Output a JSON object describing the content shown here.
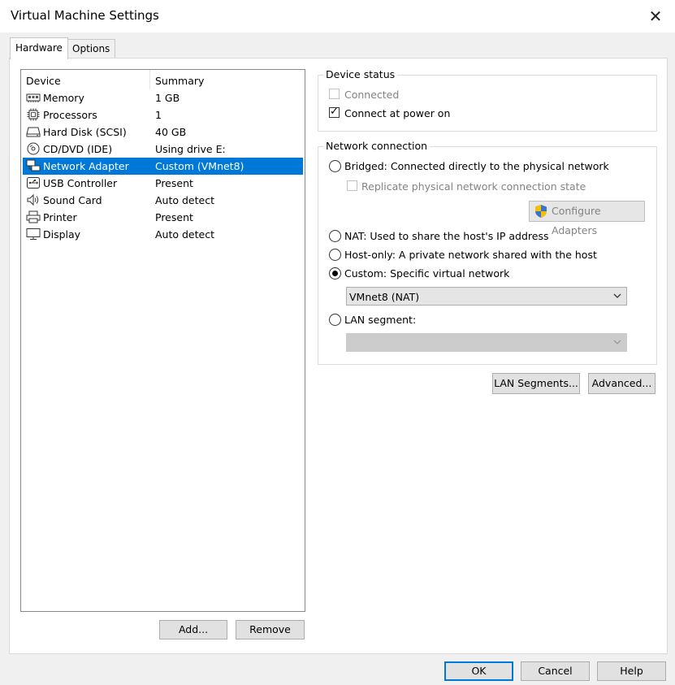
{
  "window": {
    "title": "Virtual Machine Settings"
  },
  "tabs": [
    {
      "label": "Hardware",
      "active": true
    },
    {
      "label": "Options",
      "active": false
    }
  ],
  "device_list": {
    "columns": {
      "device": "Device",
      "summary": "Summary"
    },
    "rows": [
      {
        "icon": "memory-icon",
        "name": "Memory",
        "summary": "1 GB",
        "selected": false
      },
      {
        "icon": "processor-icon",
        "name": "Processors",
        "summary": "1",
        "selected": false
      },
      {
        "icon": "hard-disk-icon",
        "name": "Hard Disk (SCSI)",
        "summary": "40 GB",
        "selected": false
      },
      {
        "icon": "cd-dvd-icon",
        "name": "CD/DVD (IDE)",
        "summary": "Using drive E:",
        "selected": false
      },
      {
        "icon": "network-adapter-icon",
        "name": "Network Adapter",
        "summary": "Custom (VMnet8)",
        "selected": true
      },
      {
        "icon": "usb-controller-icon",
        "name": "USB Controller",
        "summary": "Present",
        "selected": false
      },
      {
        "icon": "sound-card-icon",
        "name": "Sound Card",
        "summary": "Auto detect",
        "selected": false
      },
      {
        "icon": "printer-icon",
        "name": "Printer",
        "summary": "Present",
        "selected": false
      },
      {
        "icon": "display-icon",
        "name": "Display",
        "summary": "Auto detect",
        "selected": false
      }
    ]
  },
  "list_buttons": {
    "add": "Add...",
    "remove": "Remove"
  },
  "device_status": {
    "title": "Device status",
    "connected": {
      "label": "Connected",
      "checked": false,
      "enabled": false
    },
    "connect_at_power_on": {
      "label": "Connect at power on",
      "checked": true,
      "enabled": true
    }
  },
  "network_connection": {
    "title": "Network connection",
    "bridged": {
      "label": "Bridged: Connected directly to the physical network",
      "selected": false
    },
    "replicate": {
      "label": "Replicate physical network connection state",
      "checked": false,
      "enabled": false
    },
    "configure_adapters": {
      "label": "Configure Adapters",
      "enabled": false
    },
    "nat": {
      "label": "NAT: Used to share the host's IP address",
      "selected": false
    },
    "host_only": {
      "label": "Host-only: A private network shared with the host",
      "selected": false
    },
    "custom": {
      "label": "Custom: Specific virtual network",
      "selected": true
    },
    "custom_network_select": {
      "value": "VMnet8 (NAT)"
    },
    "lan_segment": {
      "label": "LAN segment:",
      "selected": false
    },
    "lan_segment_select": {
      "value": "",
      "enabled": false
    }
  },
  "panel_buttons": {
    "lan_segments": "LAN Segments...",
    "advanced": "Advanced..."
  },
  "dialog_buttons": {
    "ok": "OK",
    "cancel": "Cancel",
    "help": "Help"
  },
  "colors": {
    "selection": "#0078d7",
    "focus_border": "#0078d7",
    "shield_blue": "#3b73c8",
    "shield_yellow": "#f2c200"
  }
}
